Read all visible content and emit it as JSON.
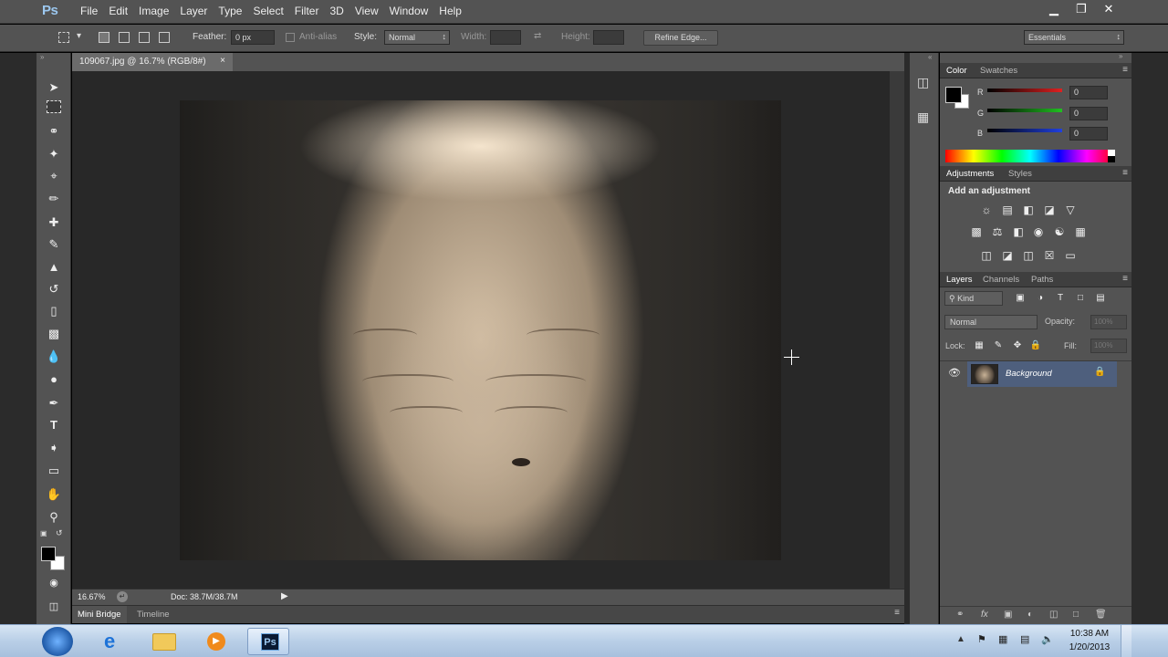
{
  "app": {
    "logo": "Ps"
  },
  "menu": [
    "File",
    "Edit",
    "Image",
    "Layer",
    "Type",
    "Select",
    "Filter",
    "3D",
    "View",
    "Window",
    "Help"
  ],
  "window_controls": {
    "minimize": "minimize-icon",
    "restore": "restore-icon",
    "close": "close-icon"
  },
  "options": {
    "feather_label": "Feather:",
    "feather_value": "0 px",
    "antialias_label": "Anti-alias",
    "style_label": "Style:",
    "style_value": "Normal",
    "width_label": "Width:",
    "height_label": "Height:",
    "refine_edge": "Refine Edge...",
    "workspace": "Essentials"
  },
  "document": {
    "tab_title": "109067.jpg @ 16.7% (RGB/8#)",
    "tab_close": "×",
    "zoom": "16.67%",
    "doc_info": "Doc: 38.7M/38.7M"
  },
  "bottom_tabs": [
    "Mini Bridge",
    "Timeline"
  ],
  "color_panel": {
    "tabs": [
      "Color",
      "Swatches"
    ],
    "channels": [
      {
        "label": "R",
        "value": "0",
        "color": "#e02020"
      },
      {
        "label": "G",
        "value": "0",
        "color": "#20c020"
      },
      {
        "label": "B",
        "value": "0",
        "color": "#2040e0"
      }
    ]
  },
  "adjustments_panel": {
    "tabs": [
      "Adjustments",
      "Styles"
    ],
    "title": "Add an adjustment"
  },
  "layers_panel": {
    "tabs": [
      "Layers",
      "Channels",
      "Paths"
    ],
    "filter_kind": "Kind",
    "blend_mode": "Normal",
    "opacity_label": "Opacity:",
    "opacity_value": "100%",
    "lock_label": "Lock:",
    "fill_label": "Fill:",
    "fill_value": "100%",
    "layers": [
      {
        "name": "Background",
        "locked": true,
        "visible": true
      }
    ]
  },
  "taskbar": {
    "time": "10:38 AM",
    "date": "1/20/2013",
    "active_app": "Ps"
  },
  "colors": {
    "accent": "#9cc8f0",
    "selected_layer": "#4e5f7d",
    "taskbar": "#b9cfe7"
  }
}
